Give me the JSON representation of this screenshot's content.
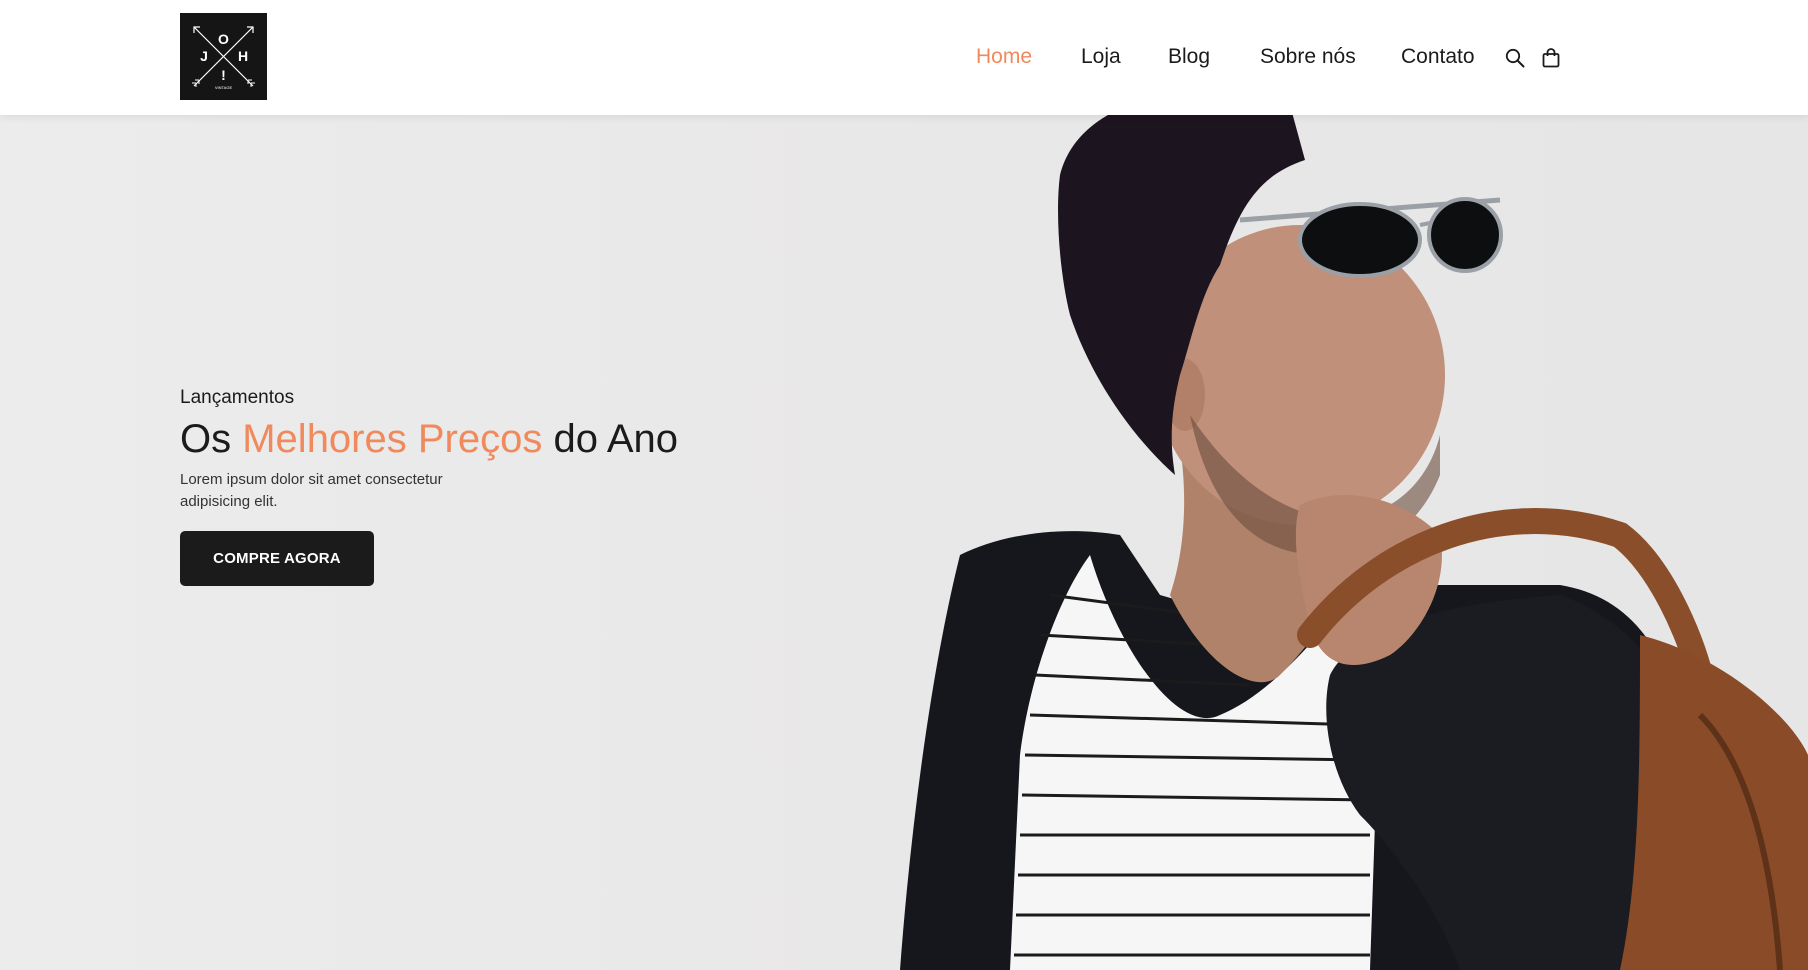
{
  "header": {
    "logo": {
      "letters": [
        "O",
        "J",
        "H",
        "!"
      ],
      "tagline": "VINTAGE"
    },
    "nav": [
      {
        "label": "Home",
        "active": true
      },
      {
        "label": "Loja",
        "active": false
      },
      {
        "label": "Blog",
        "active": false
      },
      {
        "label": "Sobre nós",
        "active": false
      },
      {
        "label": "Contato",
        "active": false
      }
    ],
    "icons": [
      "search-icon",
      "shopping-bag-icon"
    ]
  },
  "hero": {
    "kicker": "Lançamentos",
    "headline": {
      "part1": "Os ",
      "accent": "Melhores Preços",
      "part2": " do Ano"
    },
    "description": "Lorem ipsum dolor sit amet consectetur adipisicing elit.",
    "cta_label": "COMPRE AGORA"
  },
  "colors": {
    "accent": "#f08a5d",
    "dark": "#1b1b1b",
    "background": "#ebebeb"
  }
}
